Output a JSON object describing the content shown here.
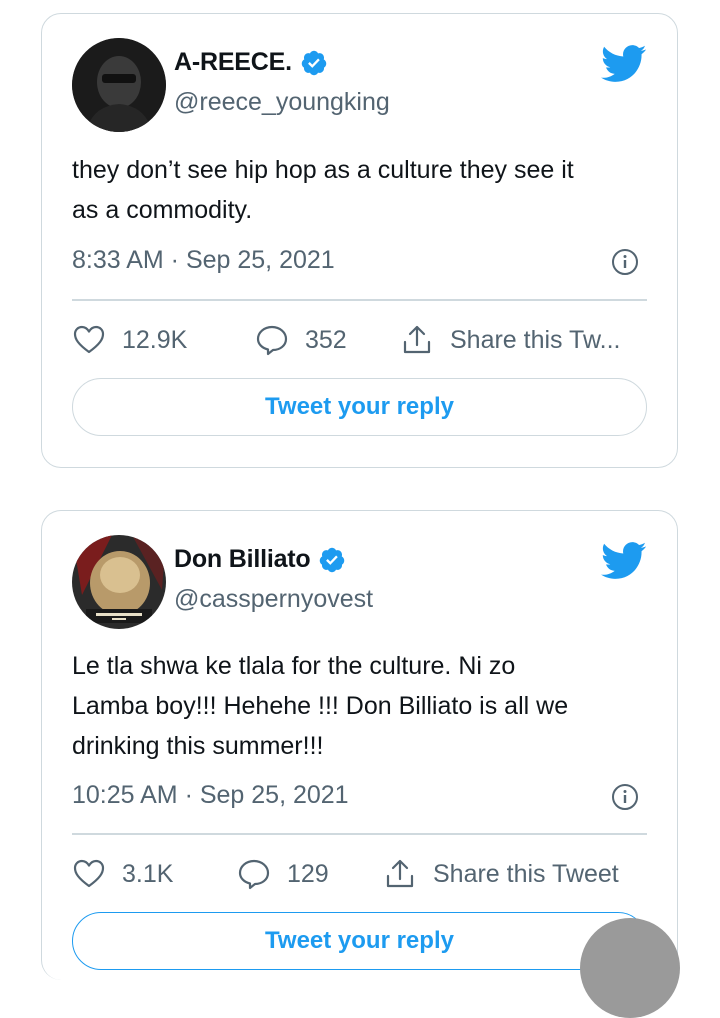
{
  "tweets": [
    {
      "display_name": "A-REECE.",
      "handle": "@reece_youngking",
      "text_line1": "they don’t see hip hop as a culture they see it",
      "text_line2": "as a commodity.",
      "timestamp": "8:33 AM · Sep 25, 2021",
      "likes": "12.9K",
      "replies": "352",
      "share_label": "Share this Tw...",
      "reply_button": "Tweet your reply",
      "verified": true
    },
    {
      "display_name": "Don Billiato",
      "handle": "@casspernyovest",
      "text_line1": "Le tla shwa ke tlala for the culture. Ni zo",
      "text_line2": "Lamba boy!!! Hehehe !!! Don Billiato is all we",
      "text_line3": "drinking this summer!!!",
      "timestamp": "10:25 AM · Sep 25, 2021",
      "likes": "3.1K",
      "replies": "129",
      "share_label": "Share this Tweet",
      "reply_button": "Tweet your reply",
      "verified": true
    }
  ],
  "colors": {
    "accent": "#1d9bf0",
    "text_primary": "#0f1419",
    "text_secondary": "#536471",
    "border": "#cfd9de"
  },
  "icons": {
    "brand": "twitter-bird-icon",
    "verified": "verified-badge-icon",
    "info": "info-icon",
    "like": "heart-icon",
    "reply": "comment-bubble-icon",
    "share": "share-upload-icon"
  }
}
